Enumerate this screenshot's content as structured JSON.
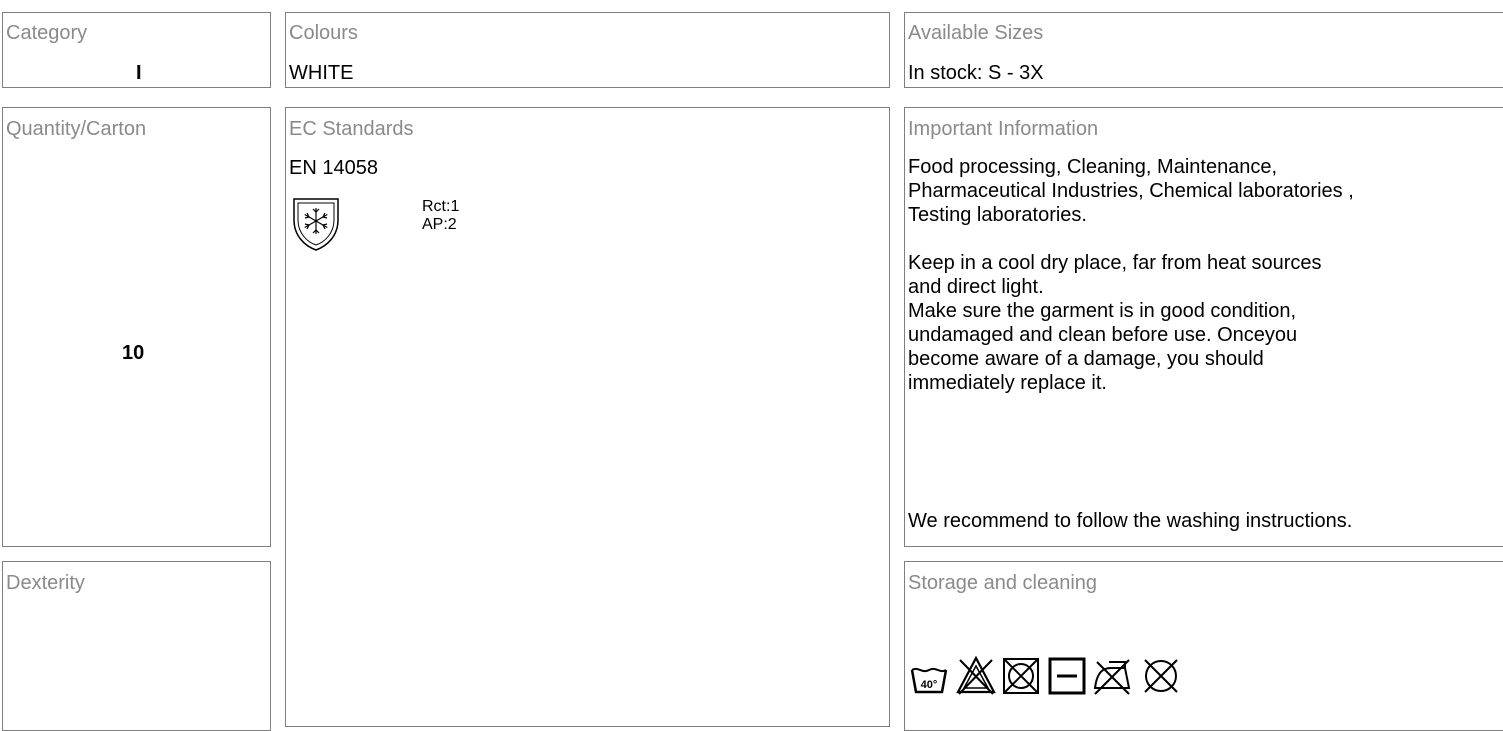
{
  "category": {
    "label": "Category",
    "value": "I"
  },
  "colours": {
    "label": "Colours",
    "value": "WHITE"
  },
  "sizes": {
    "label": "Available Sizes",
    "value": "In stock: S - 3X"
  },
  "quantity": {
    "label": "Quantity/Carton",
    "value": "10"
  },
  "ec": {
    "label": "EC Standards",
    "standard": "EN 14058",
    "icon": "cold-protection-shield-icon",
    "ratings": [
      "Rct:1",
      "AP:2"
    ]
  },
  "important": {
    "label": "Important Information",
    "usage": [
      "Food processing, Cleaning, Maintenance,",
      "Pharmaceutical Industries, Chemical laboratories ,",
      "Testing laboratories."
    ],
    "storage": [
      "Keep in a cool dry place, far from heat sources",
      "and direct light.",
      "Make sure the garment is in good condition,",
      "undamaged and clean before use. Onceyou",
      "become aware of a damage, you should",
      "immediately replace it."
    ],
    "recommend": "We recommend to follow the washing instructions."
  },
  "dexterity": {
    "label": "Dexterity"
  },
  "storage_cleaning": {
    "label": "Storage and cleaning",
    "wash_temp": "40°",
    "care_icons": [
      "wash-40-icon",
      "no-bleach-icon",
      "no-tumble-dry-icon",
      "dry-flat-icon",
      "no-iron-icon",
      "no-dry-clean-icon"
    ]
  }
}
